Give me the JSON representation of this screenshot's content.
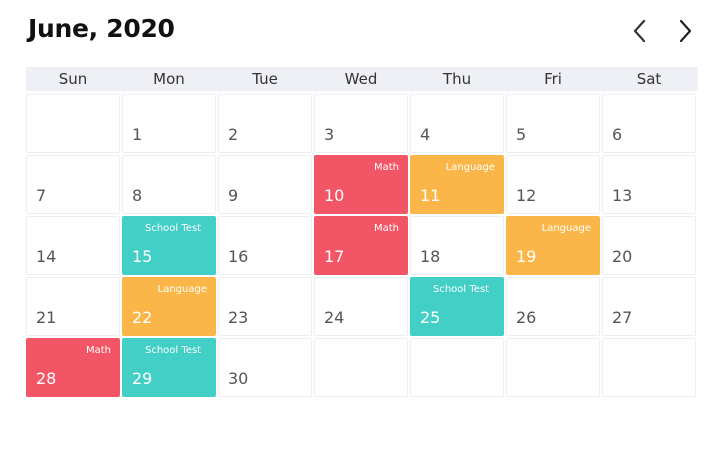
{
  "header": {
    "title": "June, 2020",
    "prev_icon": "chevron-left-icon",
    "next_icon": "chevron-right-icon"
  },
  "weekdays": [
    "Sun",
    "Mon",
    "Tue",
    "Wed",
    "Thu",
    "Fri",
    "Sat"
  ],
  "colors": {
    "math": "#f25565",
    "language": "#fab648",
    "school_test": "#42cfc6"
  },
  "days": [
    {
      "num": "",
      "event": "",
      "type": ""
    },
    {
      "num": "1",
      "event": "",
      "type": ""
    },
    {
      "num": "2",
      "event": "",
      "type": ""
    },
    {
      "num": "3",
      "event": "",
      "type": ""
    },
    {
      "num": "4",
      "event": "",
      "type": ""
    },
    {
      "num": "5",
      "event": "",
      "type": ""
    },
    {
      "num": "6",
      "event": "",
      "type": ""
    },
    {
      "num": "7",
      "event": "",
      "type": ""
    },
    {
      "num": "8",
      "event": "",
      "type": ""
    },
    {
      "num": "9",
      "event": "",
      "type": ""
    },
    {
      "num": "10",
      "event": "Math",
      "type": "math"
    },
    {
      "num": "11",
      "event": "Language",
      "type": "language"
    },
    {
      "num": "12",
      "event": "",
      "type": ""
    },
    {
      "num": "13",
      "event": "",
      "type": ""
    },
    {
      "num": "14",
      "event": "",
      "type": ""
    },
    {
      "num": "15",
      "event": "School Test",
      "type": "school"
    },
    {
      "num": "16",
      "event": "",
      "type": ""
    },
    {
      "num": "17",
      "event": "Math",
      "type": "math"
    },
    {
      "num": "18",
      "event": "",
      "type": ""
    },
    {
      "num": "19",
      "event": "Language",
      "type": "language"
    },
    {
      "num": "20",
      "event": "",
      "type": ""
    },
    {
      "num": "21",
      "event": "",
      "type": ""
    },
    {
      "num": "22",
      "event": "Language",
      "type": "language"
    },
    {
      "num": "23",
      "event": "",
      "type": ""
    },
    {
      "num": "24",
      "event": "",
      "type": ""
    },
    {
      "num": "25",
      "event": "School Test",
      "type": "school"
    },
    {
      "num": "26",
      "event": "",
      "type": ""
    },
    {
      "num": "27",
      "event": "",
      "type": ""
    },
    {
      "num": "28",
      "event": "Math",
      "type": "math"
    },
    {
      "num": "29",
      "event": "School Test",
      "type": "school"
    },
    {
      "num": "30",
      "event": "",
      "type": ""
    },
    {
      "num": "",
      "event": "",
      "type": ""
    },
    {
      "num": "",
      "event": "",
      "type": ""
    },
    {
      "num": "",
      "event": "",
      "type": ""
    },
    {
      "num": "",
      "event": "",
      "type": ""
    }
  ]
}
